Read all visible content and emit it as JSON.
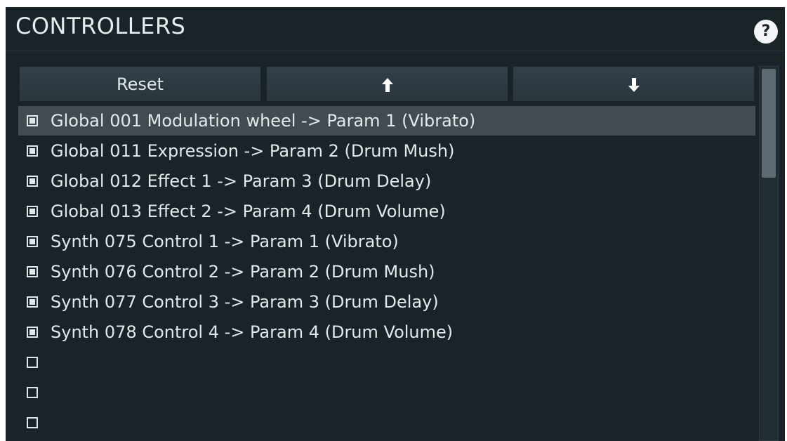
{
  "header": {
    "title": "CONTROLLERS",
    "help_label": "?"
  },
  "toolbar": {
    "reset_label": "Reset"
  },
  "controllers": [
    {
      "label": "Global 001 Modulation wheel -> Param 1 (Vibrato)",
      "checked": true,
      "selected": true
    },
    {
      "label": "Global 011 Expression -> Param 2 (Drum Mush)",
      "checked": true,
      "selected": false
    },
    {
      "label": "Global 012 Effect 1 -> Param 3 (Drum Delay)",
      "checked": true,
      "selected": false
    },
    {
      "label": "Global 013 Effect 2 -> Param 4 (Drum Volume)",
      "checked": true,
      "selected": false
    },
    {
      "label": "Synth 075 Control 1 -> Param 1 (Vibrato)",
      "checked": true,
      "selected": false
    },
    {
      "label": "Synth 076 Control 2 -> Param 2 (Drum Mush)",
      "checked": true,
      "selected": false
    },
    {
      "label": "Synth 077 Control 3 -> Param 3 (Drum Delay)",
      "checked": true,
      "selected": false
    },
    {
      "label": "Synth 078 Control 4 -> Param 4 (Drum Volume)",
      "checked": true,
      "selected": false
    },
    {
      "label": "",
      "checked": false,
      "selected": false
    },
    {
      "label": "",
      "checked": false,
      "selected": false
    },
    {
      "label": "",
      "checked": false,
      "selected": false
    }
  ]
}
